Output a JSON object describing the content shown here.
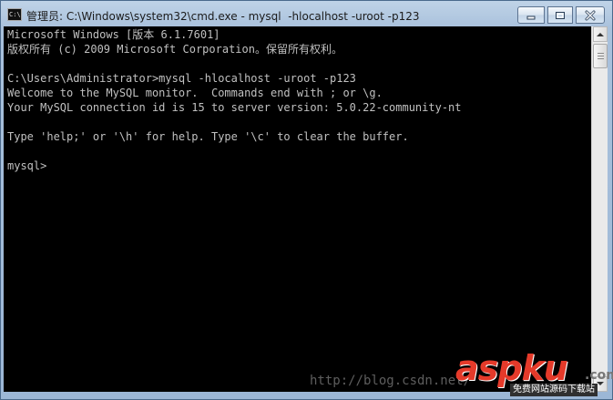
{
  "window": {
    "title": "管理员: C:\\Windows\\system32\\cmd.exe - mysql  -hlocalhost -uroot -p123",
    "icon": "console-icon",
    "controls": {
      "minimize": "minimize-icon",
      "maximize": "maximize-icon",
      "close": "close-icon"
    }
  },
  "console": {
    "lines": [
      "Microsoft Windows [版本 6.1.7601]",
      "版权所有 (c) 2009 Microsoft Corporation。保留所有权利。",
      "",
      "C:\\Users\\Administrator>mysql -hlocalhost -uroot -p123",
      "Welcome to the MySQL monitor.  Commands end with ; or \\g.",
      "Your MySQL connection id is 15 to server version: 5.0.22-community-nt",
      "",
      "Type 'help;' or '\\h' for help. Type '\\c' to clear the buffer.",
      "",
      "mysql>"
    ],
    "background": "#000000",
    "foreground": "#c0c0c0"
  },
  "watermark": {
    "url": "http://blog.csdn.net/",
    "logo": "aspku",
    "logo_suffix": ".com",
    "logo_tagline": "免费网站源码下载站"
  },
  "colors": {
    "titlebar": "#a9c1dc",
    "logo_red": "#e53a2a"
  }
}
